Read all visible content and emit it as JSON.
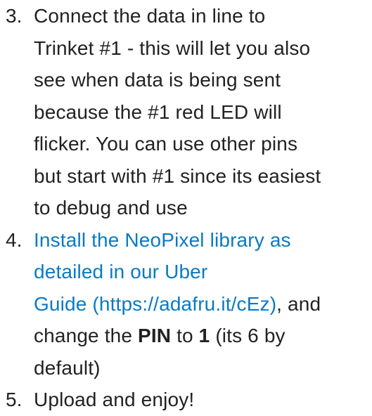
{
  "steps": [
    {
      "number": "3.",
      "lines": [
        "Connect the data in line to",
        "Trinket #1 - this will let you also",
        "see when data is being sent",
        "because the #1 red LED will",
        "flicker. You can use other pins",
        "but start with #1 since its easiest",
        "to debug and use"
      ]
    },
    {
      "number": "4.",
      "link_line1": "Install the NeoPixel library as",
      "link_line2": "detailed in our Uber",
      "link_line3": "Guide (https://adafru.it/cEz)",
      "after_link": ", and",
      "l4_pre": "change the ",
      "l4_pin": "PIN",
      "l4_mid": " to ",
      "l4_one": "1",
      "l4_post": " (its 6 by",
      "l5": "default)"
    },
    {
      "number": "5.",
      "text": "Upload and enjoy!"
    }
  ],
  "colors": {
    "text": "#222222",
    "link": "#0a7ac4",
    "background": "#ffffff"
  }
}
